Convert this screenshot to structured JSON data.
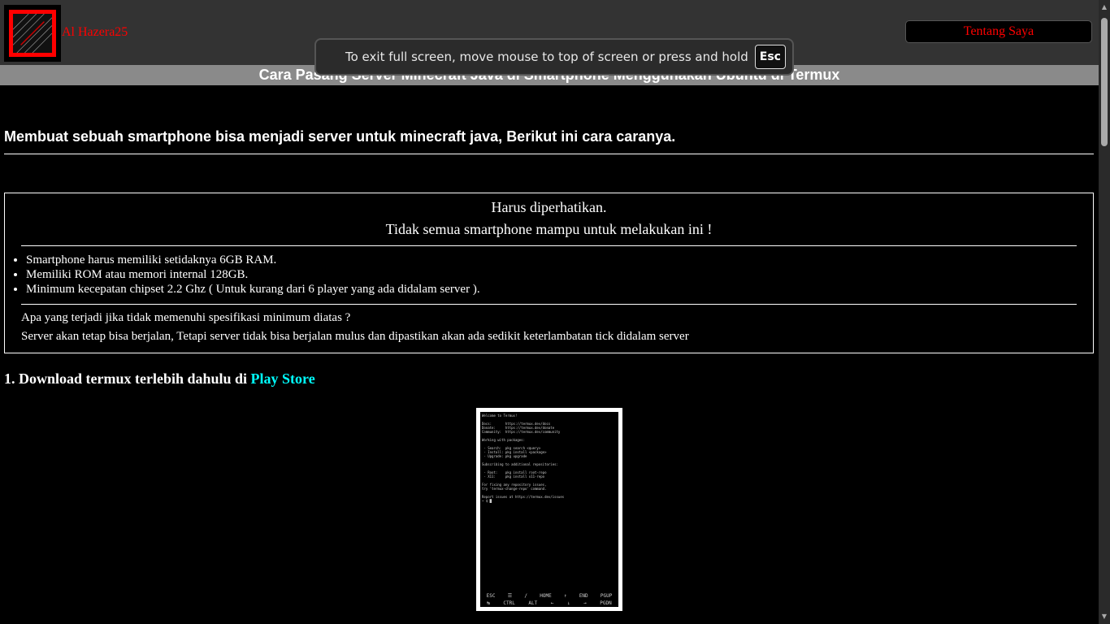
{
  "header": {
    "brand": "Al Hazera25",
    "about_button": "Tentang Saya"
  },
  "fullscreen_toast": {
    "message": "To exit full screen, move mouse to top of screen or press and hold",
    "key": "Esc"
  },
  "article": {
    "title": "Cara Pasang Server Minecraft Java di Smartphone Menggunakan Ubuntu di Termux",
    "intro": "Membuat sebuah smartphone bisa menjadi server untuk minecraft java, Berikut ini cara caranya.",
    "notice": {
      "title": "Harus diperhatikan.",
      "subtitle": "Tidak semua smartphone mampu untuk melakukan ini !",
      "requirements": [
        "Smartphone harus memiliki setidaknya 6GB RAM.",
        "Memiliki ROM atau memori internal 128GB.",
        "Minimum kecepatan chipset 2.2 Ghz ( Untuk kurang dari 6 player yang ada didalam server )."
      ],
      "question": "Apa yang terjadi jika tidak memenuhi spesifikasi minimum diatas ?",
      "answer": "Server akan tetap bisa berjalan, Tetapi server tidak bisa berjalan mulus dan dipastikan akan ada sedikit keterlambatan tick didalam server"
    },
    "step1": {
      "text": "1. Download termux terlebih dahulu di ",
      "link": "Play Store"
    },
    "screenshot_terminal": [
      "Welcome to Termux!",
      "",
      "Docs:       https://termux.dev/docs",
      "Donate:     https://termux.dev/donate",
      "Community:  https://termux.dev/community",
      "",
      "Working with packages:",
      "",
      " - Search:  pkg search <query>",
      " - Install: pkg install <package>",
      " - Upgrade: pkg upgrade",
      "",
      "Subscribing to additional repositories:",
      "",
      " - Root:    pkg install root-repo",
      " - X11:     pkg install x11-repo",
      "",
      "For fixing any repository issues,",
      "try 'termux-change-repo' command.",
      "",
      "Report issues at https://termux.dev/issues",
      "~ $ █"
    ],
    "screenshot_keys_row1": [
      "ESC",
      "☰",
      "/",
      "HOME",
      "↑",
      "END",
      "PGUP"
    ],
    "screenshot_keys_row2": [
      "↹",
      "CTRL",
      "ALT",
      "←",
      "↓",
      "→",
      "PGDN"
    ]
  }
}
